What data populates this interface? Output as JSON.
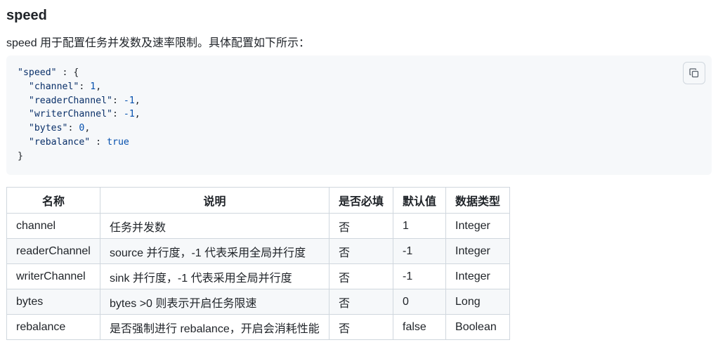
{
  "section": {
    "title": "speed",
    "intro": "speed 用于配置任务并发数及速率限制。具体配置如下所示："
  },
  "code": {
    "lines": [
      {
        "tokens": [
          {
            "t": "\"speed\"",
            "c": "str"
          },
          {
            "t": " : {",
            "c": ""
          }
        ]
      },
      {
        "tokens": [
          {
            "t": "  ",
            "c": ""
          },
          {
            "t": "\"channel\"",
            "c": "str"
          },
          {
            "t": ": ",
            "c": ""
          },
          {
            "t": "1",
            "c": "num"
          },
          {
            "t": ",",
            "c": ""
          }
        ]
      },
      {
        "tokens": [
          {
            "t": "  ",
            "c": ""
          },
          {
            "t": "\"readerChannel\"",
            "c": "str"
          },
          {
            "t": ": ",
            "c": ""
          },
          {
            "t": "-1",
            "c": "num"
          },
          {
            "t": ",",
            "c": ""
          }
        ]
      },
      {
        "tokens": [
          {
            "t": "  ",
            "c": ""
          },
          {
            "t": "\"writerChannel\"",
            "c": "str"
          },
          {
            "t": ": ",
            "c": ""
          },
          {
            "t": "-1",
            "c": "num"
          },
          {
            "t": ",",
            "c": ""
          }
        ]
      },
      {
        "tokens": [
          {
            "t": "  ",
            "c": ""
          },
          {
            "t": "\"bytes\"",
            "c": "str"
          },
          {
            "t": ": ",
            "c": ""
          },
          {
            "t": "0",
            "c": "num"
          },
          {
            "t": ",",
            "c": ""
          }
        ]
      },
      {
        "tokens": [
          {
            "t": "  ",
            "c": ""
          },
          {
            "t": "\"rebalance\"",
            "c": "str"
          },
          {
            "t": " : ",
            "c": ""
          },
          {
            "t": "true",
            "c": "kw"
          }
        ]
      },
      {
        "tokens": [
          {
            "t": "}",
            "c": ""
          }
        ]
      }
    ],
    "copy_icon": "copy-icon"
  },
  "table": {
    "headers": [
      "名称",
      "说明",
      "是否必填",
      "默认值",
      "数据类型"
    ],
    "rows": [
      [
        "channel",
        "任务并发数",
        "否",
        "1",
        "Integer"
      ],
      [
        "readerChannel",
        "source 并行度，-1 代表采用全局并行度",
        "否",
        "-1",
        "Integer"
      ],
      [
        "writerChannel",
        "sink 并行度，-1 代表采用全局并行度",
        "否",
        "-1",
        "Integer"
      ],
      [
        "bytes",
        "bytes >0 则表示开启任务限速",
        "否",
        "0",
        "Long"
      ],
      [
        "rebalance",
        "是否强制进行 rebalance，开启会消耗性能",
        "否",
        "false",
        "Boolean"
      ]
    ]
  }
}
